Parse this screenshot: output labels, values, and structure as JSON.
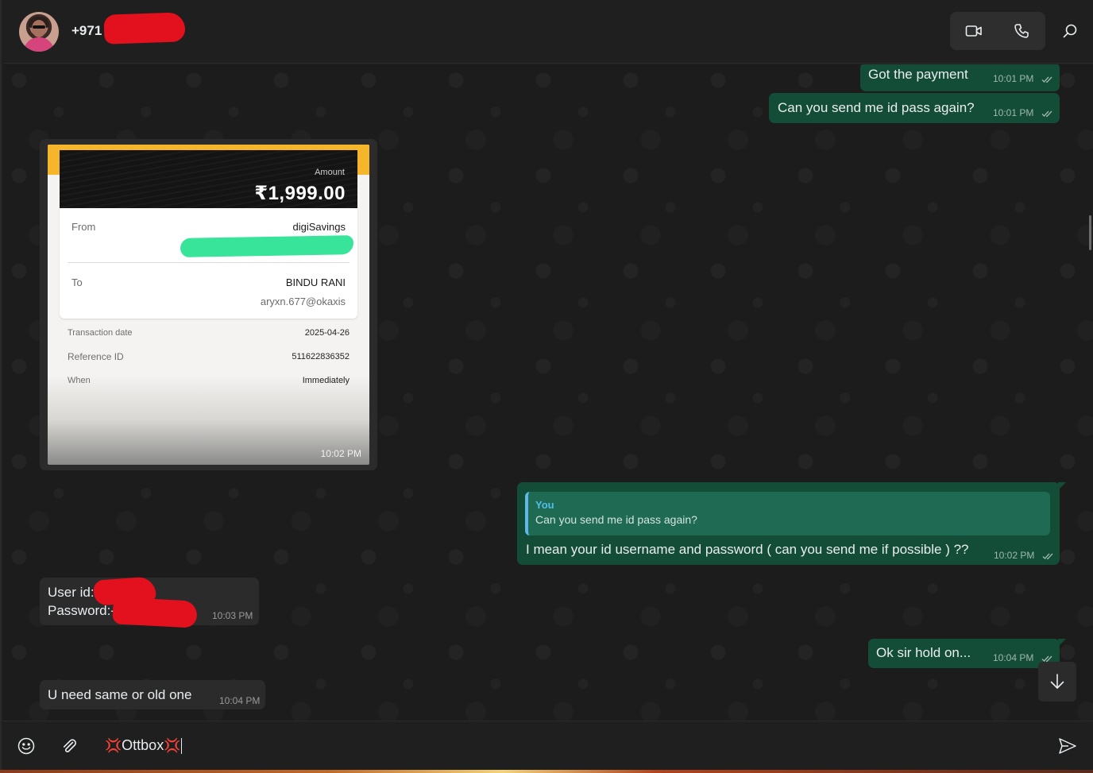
{
  "header": {
    "contact_name": "+971",
    "video_call_icon": "video-camera-icon",
    "voice_call_icon": "phone-icon",
    "search_icon": "search-icon"
  },
  "messages": [
    {
      "direction": "out",
      "text": "Got the payment",
      "time": "10:01 PM",
      "status": "read"
    },
    {
      "direction": "out",
      "text": "Can you send me id pass again?",
      "time": "10:01 PM",
      "status": "read"
    },
    {
      "direction": "in",
      "type": "image",
      "time": "10:02 PM",
      "receipt": {
        "amount_label": "Amount",
        "amount": "₹1,999.00",
        "from_label": "From",
        "from_value": "digiSavings",
        "to_label": "To",
        "to_name": "BINDU RANI",
        "to_upi": "aryxn.677@okaxis",
        "details": [
          {
            "label": "Transaction date",
            "value": "2025-04-26"
          },
          {
            "label": "Reference ID",
            "value": "511622836352"
          },
          {
            "label": "When",
            "value": "Immediately"
          }
        ]
      }
    },
    {
      "direction": "out",
      "reply_to": {
        "author": "You",
        "text": "Can you send me id pass again?"
      },
      "text": "I mean your id username and password ( can you send me if possible ) ??",
      "time": "10:02 PM",
      "status": "read"
    },
    {
      "direction": "in",
      "line1": "User id:-",
      "line2": "Password:-",
      "time": "10:03 PM"
    },
    {
      "direction": "out",
      "text": "Ok sir hold on...",
      "time": "10:04 PM",
      "status": "read"
    },
    {
      "direction": "in",
      "text": "U need same or old one",
      "time": "10:04 PM"
    }
  ],
  "composer": {
    "draft_text": "Ottbox",
    "emoji_icon": "smiley-icon",
    "attach_icon": "paperclip-icon",
    "send_icon": "send-icon"
  },
  "colors": {
    "outgoing_bubble": "#144d37",
    "incoming_bubble": "#2b2b2b",
    "reply_accent": "#53bdeb",
    "redaction": "#e3101e"
  }
}
